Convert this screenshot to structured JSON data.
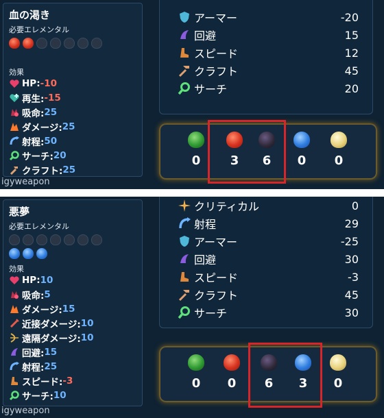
{
  "panels": [
    {
      "item_name": "血の渇き",
      "required_label": "必要エレメンタル",
      "effects_label": "効果",
      "elements_row1": [
        "fire",
        "fire",
        "empty",
        "empty",
        "empty",
        "empty",
        "empty"
      ],
      "effects": [
        {
          "icon": "heart-icon",
          "name": "HP:",
          "value": "-10",
          "value_color": "#ff6b5a"
        },
        {
          "icon": "regen-heart-icon",
          "name": "再生:",
          "value": "-15",
          "value_color": "#ff6b5a"
        },
        {
          "icon": "lifesteal-icon",
          "name": "吸命:",
          "value": "25",
          "value_color": "#6fb4ff"
        },
        {
          "icon": "damage-icon",
          "name": "ダメージ:",
          "value": "25",
          "value_color": "#6fb4ff"
        },
        {
          "icon": "range-icon",
          "name": "射程:",
          "value": "50",
          "value_color": "#6fb4ff"
        },
        {
          "icon": "search-icon",
          "name": "サーチ:",
          "value": "20",
          "value_color": "#6fb4ff"
        },
        {
          "icon": "craft-icon",
          "name": "クラフト:",
          "value": "25",
          "value_color": "#6fb4ff"
        }
      ],
      "bottom_text": "igyweapon",
      "stats": [
        {
          "icon": "armor-icon",
          "name": "アーマー",
          "value": "-20"
        },
        {
          "icon": "dodge-icon",
          "name": "回避",
          "value": "15"
        },
        {
          "icon": "speed-icon",
          "name": "スピード",
          "value": "12"
        },
        {
          "icon": "craft-icon",
          "name": "クラフト",
          "value": "45"
        },
        {
          "icon": "search-icon",
          "name": "サーチ",
          "value": "20"
        }
      ],
      "element_counts": [
        {
          "element": "earth",
          "count": "0"
        },
        {
          "element": "fire",
          "count": "3"
        },
        {
          "element": "dark",
          "count": "6"
        },
        {
          "element": "water",
          "count": "0"
        },
        {
          "element": "light",
          "count": "0"
        }
      ]
    },
    {
      "item_name": "悪夢",
      "required_label": "必要エレメンタル",
      "effects_label": "効果",
      "elements_row1": [
        "empty",
        "empty",
        "empty",
        "empty",
        "empty",
        "empty",
        "empty"
      ],
      "elements_row2": [
        "water",
        "water",
        "water"
      ],
      "effects": [
        {
          "icon": "heart-icon",
          "name": "HP:",
          "value": "10",
          "value_color": "#6fb4ff"
        },
        {
          "icon": "lifesteal-icon",
          "name": "吸命:",
          "value": "5",
          "value_color": "#6fb4ff"
        },
        {
          "icon": "damage-icon",
          "name": "ダメージ:",
          "value": "15",
          "value_color": "#6fb4ff"
        },
        {
          "icon": "melee-icon",
          "name": "近接ダメージ:",
          "value": "10",
          "value_color": "#6fb4ff"
        },
        {
          "icon": "ranged-icon",
          "name": "遠隔ダメージ:",
          "value": "10",
          "value_color": "#6fb4ff"
        },
        {
          "icon": "dodge-icon",
          "name": "回避:",
          "value": "15",
          "value_color": "#6fb4ff"
        },
        {
          "icon": "range-icon",
          "name": "射程:",
          "value": "25",
          "value_color": "#6fb4ff"
        },
        {
          "icon": "speed-icon",
          "name": "スピード:",
          "value": "-3",
          "value_color": "#ff6b5a"
        },
        {
          "icon": "search-icon",
          "name": "サーチ:",
          "value": "10",
          "value_color": "#6fb4ff"
        }
      ],
      "bottom_text": "igyweapon",
      "stats": [
        {
          "icon": "critical-icon",
          "name": "クリティカル",
          "value": "0"
        },
        {
          "icon": "range-icon",
          "name": "射程",
          "value": "29"
        },
        {
          "icon": "armor-icon",
          "name": "アーマー",
          "value": "-25"
        },
        {
          "icon": "dodge-icon",
          "name": "回避",
          "value": "30"
        },
        {
          "icon": "speed-icon",
          "name": "スピード",
          "value": "-3"
        },
        {
          "icon": "craft-icon",
          "name": "クラフト",
          "value": "45"
        },
        {
          "icon": "search-icon",
          "name": "サーチ",
          "value": "30"
        }
      ],
      "element_counts": [
        {
          "element": "earth",
          "count": "0"
        },
        {
          "element": "fire",
          "count": "0"
        },
        {
          "element": "dark",
          "count": "6"
        },
        {
          "element": "water",
          "count": "3"
        },
        {
          "element": "light",
          "count": "0"
        }
      ]
    }
  ]
}
